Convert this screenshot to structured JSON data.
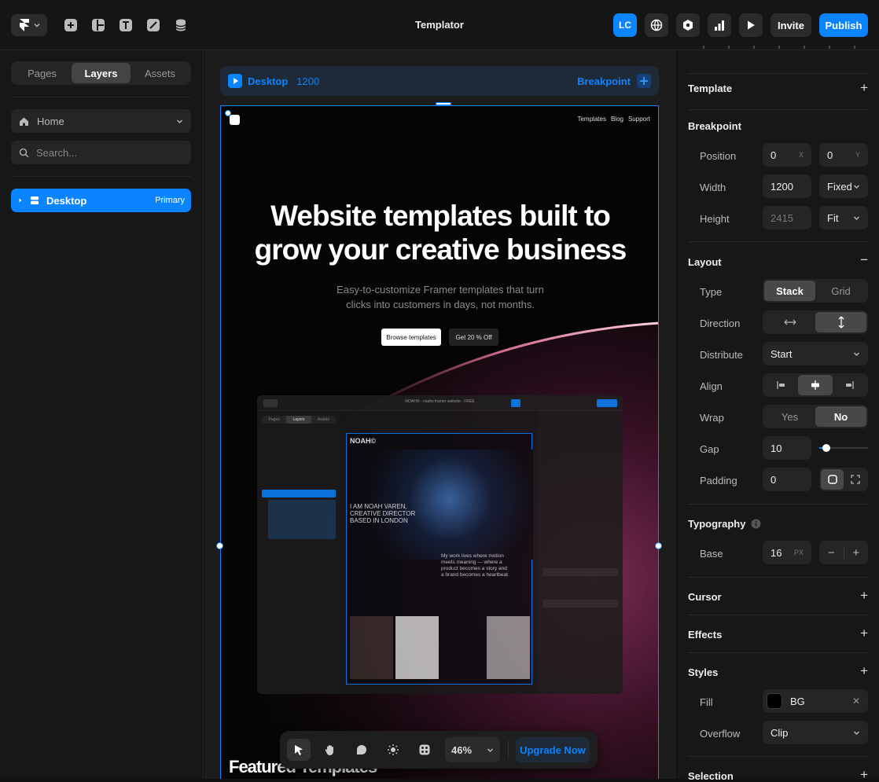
{
  "topbar": {
    "title": "Templator",
    "avatar": "LC",
    "invite": "Invite",
    "publish": "Publish",
    "icons": [
      "framer-logo-icon",
      "insert-icon",
      "layout-icon",
      "text-icon",
      "vector-icon",
      "cms-icon",
      "globe-icon",
      "settings-icon",
      "analytics-icon",
      "play-icon"
    ]
  },
  "left": {
    "tabs": [
      "Pages",
      "Layers",
      "Assets"
    ],
    "active_tab": "Layers",
    "page_select": "Home",
    "search_placeholder": "Search...",
    "layers": [
      {
        "label": "Desktop",
        "badge": "Primary"
      }
    ]
  },
  "canvas": {
    "breakpoint_name": "Desktop",
    "breakpoint_width": "1200",
    "breakpoint_action": "Breakpoint",
    "nav_links": [
      "Templates",
      "Blog",
      "Support"
    ],
    "hero_title_1": "Website templates built to",
    "hero_title_2": "grow your creative business",
    "hero_sub_1": "Easy-to-customize Framer templates that turn",
    "hero_sub_2": "clicks into customers in days, not months.",
    "btn_primary": "Browse templates",
    "btn_secondary": "Get 20 % Off",
    "featured": "Featured Templates",
    "mock": {
      "title": "NOAH® - noahs framer website - FREE",
      "tabs": [
        "Pages",
        "Layers",
        "Assets"
      ],
      "headline_1": "I AM NOAH VAREN,",
      "headline_2": "CREATIVE DIRECTOR",
      "headline_3": "BASED IN LONDON",
      "logo": "NOAH©",
      "paragraph_1": "My work lives where motion",
      "paragraph_2": "meets meaning — where a",
      "paragraph_3": "product becomes a story and",
      "paragraph_4": "a brand becomes a heartbeat."
    }
  },
  "toolbar": {
    "zoom": "46%",
    "upgrade": "Upgrade Now"
  },
  "right": {
    "template": "Template",
    "breakpoint": {
      "title": "Breakpoint",
      "position_label": "Position",
      "pos_x": "0",
      "pos_x_unit": "X",
      "pos_y": "0",
      "pos_y_unit": "Y",
      "width_label": "Width",
      "width": "1200",
      "width_mode": "Fixed",
      "height_label": "Height",
      "height": "2415",
      "height_mode": "Fit"
    },
    "layout": {
      "title": "Layout",
      "type_label": "Type",
      "type_options": [
        "Stack",
        "Grid"
      ],
      "type_active": "Stack",
      "direction_label": "Direction",
      "distribute_label": "Distribute",
      "distribute": "Start",
      "align_label": "Align",
      "wrap_label": "Wrap",
      "wrap_options": [
        "Yes",
        "No"
      ],
      "wrap_active": "No",
      "gap_label": "Gap",
      "gap": "10",
      "padding_label": "Padding",
      "padding": "0"
    },
    "typography": {
      "title": "Typography",
      "base_label": "Base",
      "base": "16",
      "base_unit": "PX"
    },
    "cursor": "Cursor",
    "effects": "Effects",
    "styles": {
      "title": "Styles",
      "fill_label": "Fill",
      "fill": "BG",
      "overflow_label": "Overflow",
      "overflow": "Clip"
    },
    "selection": "Selection"
  },
  "colors": {
    "accent": "#0a84ff",
    "bg": "#171717",
    "canvas": "#1c1c1c"
  }
}
